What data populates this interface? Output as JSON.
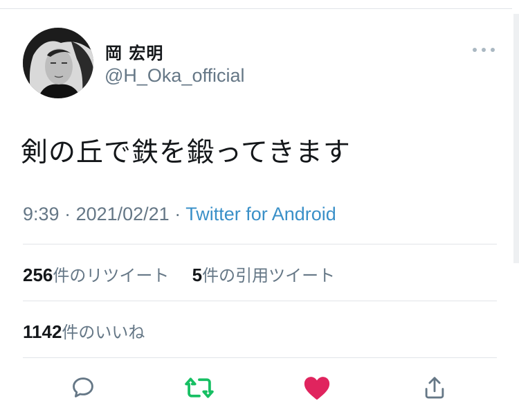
{
  "tweet": {
    "author_name": "岡 宏明",
    "author_handle": "@H_Oka_official",
    "text": "剣の丘で鉄を鍛ってきます",
    "time": "9:39",
    "separator1": " · ",
    "date": "2021/02/21",
    "separator2": " · ",
    "source": "Twitter for Android"
  },
  "stats": {
    "retweets_count": "256",
    "retweets_label": "件のリツイート",
    "quotes_count": "5",
    "quotes_label": "件の引用ツイート",
    "likes_count": "1142",
    "likes_label": "件のいいね"
  },
  "colors": {
    "text_primary": "#14171a",
    "text_secondary": "#657786",
    "link": "#3a90c8",
    "retweet_active": "#17bf63",
    "like_active": "#e0245e",
    "icon_default": "#657786"
  },
  "icons": {
    "reply": "speech-bubble-icon",
    "retweet": "retweet-icon",
    "like": "heart-icon",
    "share": "share-icon",
    "more": "more-dots-icon"
  }
}
